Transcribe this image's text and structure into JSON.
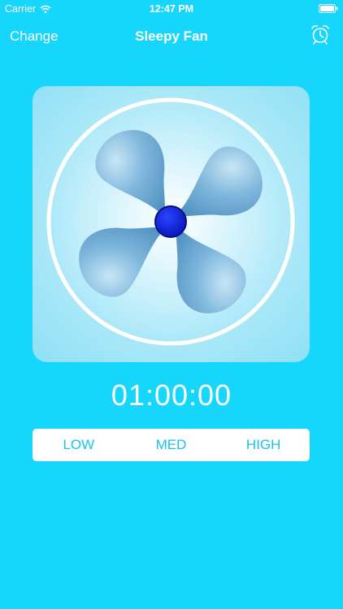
{
  "status_bar": {
    "carrier": "Carrier",
    "time": "12:47 PM",
    "icons": [
      "wifi-icon",
      "battery-icon"
    ]
  },
  "nav": {
    "left_button": "Change",
    "title": "Sleepy Fan",
    "right_icon": "alarm-clock-icon"
  },
  "fan": {
    "icon": "fan-icon",
    "hub_color": "#0a1ee0",
    "blade_color": "#5b9bc8"
  },
  "timer": {
    "value": "01:00:00"
  },
  "speed": {
    "options": [
      "LOW",
      "MED",
      "HIGH"
    ]
  },
  "colors": {
    "background": "#17d6fb",
    "accent_text": "#17c3ea"
  }
}
